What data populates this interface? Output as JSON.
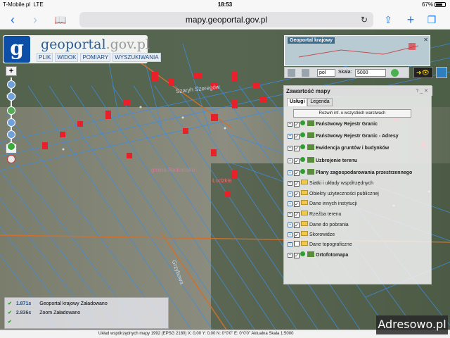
{
  "status_bar": {
    "carrier": "T-Mobile.pl",
    "network": "LTE",
    "time": "18:53",
    "battery": "67%"
  },
  "browser": {
    "url": "mapy.geoportal.gov.pl"
  },
  "logo": {
    "text_main": "geoportal",
    "text_dot": ".gov.pl"
  },
  "main_menu": [
    "PLIK",
    "WIDOK",
    "POMIARY",
    "WYSZUKIWANIA"
  ],
  "overview": {
    "title": "Geoportal krajowy"
  },
  "toolbar": {
    "projection": "pol",
    "scale_label": "Skala:",
    "scale_value": "5000"
  },
  "map_labels": {
    "street1": "Szaryh Szeregów",
    "place1": "gmina Radomsko",
    "place2": "Łodzkie",
    "street2": "Grzybowa"
  },
  "layers_panel": {
    "title": "Zawartość mapy",
    "tabs": [
      "Usługi",
      "Legenda"
    ],
    "expand_button": "Rozwiń inf. o wszystkich warstwach",
    "items": [
      {
        "label": "Państwowy Rejestr Granic",
        "checked": true,
        "type": "service",
        "bold": true
      },
      {
        "label": "Państwowy Rejestr Granic - Adresy",
        "checked": true,
        "type": "service",
        "bold": true
      },
      {
        "label": "Ewidencja gruntów i budynków",
        "checked": true,
        "type": "service",
        "bold": true
      },
      {
        "label": "Uzbrojenie terenu",
        "checked": true,
        "type": "service",
        "bold": true
      },
      {
        "label": "Plany zagospodarowania przestrzennego",
        "checked": true,
        "type": "service",
        "bold": true
      },
      {
        "label": "Siatki i układy współrzędnych",
        "checked": true,
        "type": "folder",
        "bold": false
      },
      {
        "label": "Obiekty użyteczności publicznej",
        "checked": true,
        "type": "folder",
        "bold": false
      },
      {
        "label": "Dane innych instytucji",
        "checked": true,
        "type": "folder",
        "bold": false
      },
      {
        "label": "Rzeźba terenu",
        "checked": true,
        "type": "folder",
        "bold": false
      },
      {
        "label": "Dane do pobrania",
        "checked": true,
        "type": "folder",
        "bold": false
      },
      {
        "label": "Skorowidze",
        "checked": true,
        "type": "folder",
        "bold": false
      },
      {
        "label": "Dane topograficzne",
        "checked": false,
        "type": "folder",
        "bold": false
      },
      {
        "label": "Ortofotomapa",
        "checked": true,
        "type": "service",
        "bold": true
      }
    ]
  },
  "status_panel": {
    "rows": [
      {
        "time": "1.871s",
        "source": "Geoportal krajowy",
        "state": "Załadowano"
      },
      {
        "time": "2.836s",
        "source": "Zoom",
        "state": "Załadowano"
      }
    ]
  },
  "bottom_bar": {
    "text": "Układ współrzędnych mapy 1992 (EPSG 2180)   X: 0,00 Y: 0,00 N: 0°0'0\" E: 0°0'0\"  Aktualna Skala 1:5000"
  },
  "watermark": "Adresowo.pl",
  "colors": {
    "parcel_lines": "#3a8ee8",
    "buildings": "#e8202a",
    "roads": "#d0702c"
  }
}
